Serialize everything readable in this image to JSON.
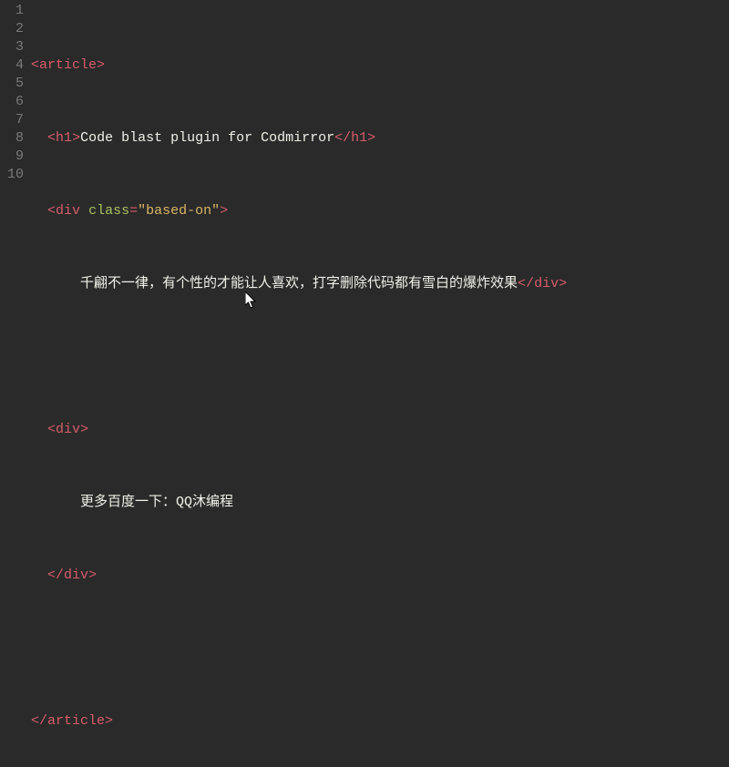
{
  "gutter": [
    "1",
    "2",
    "3",
    "4",
    "5",
    "6",
    "7",
    "8",
    "9",
    "10"
  ],
  "tokens": {
    "lt": "<",
    "gt": ">",
    "ltslash": "</",
    "article": "article",
    "h1": "h1",
    "div": "div",
    "class_attr": "class",
    "eq": "=",
    "q": "\"",
    "based_on": "based-on"
  },
  "content": {
    "h1_text": "Code blast plugin for Codmirror",
    "line4_text": "千翩不一律，有个性的才能让人喜欢，打字删除代码都有雪白的爆炸效果",
    "line7_text": "更多百度一下：QQ沐编程"
  },
  "indent": {
    "one": "  ",
    "two": "    ",
    "three": "      "
  }
}
